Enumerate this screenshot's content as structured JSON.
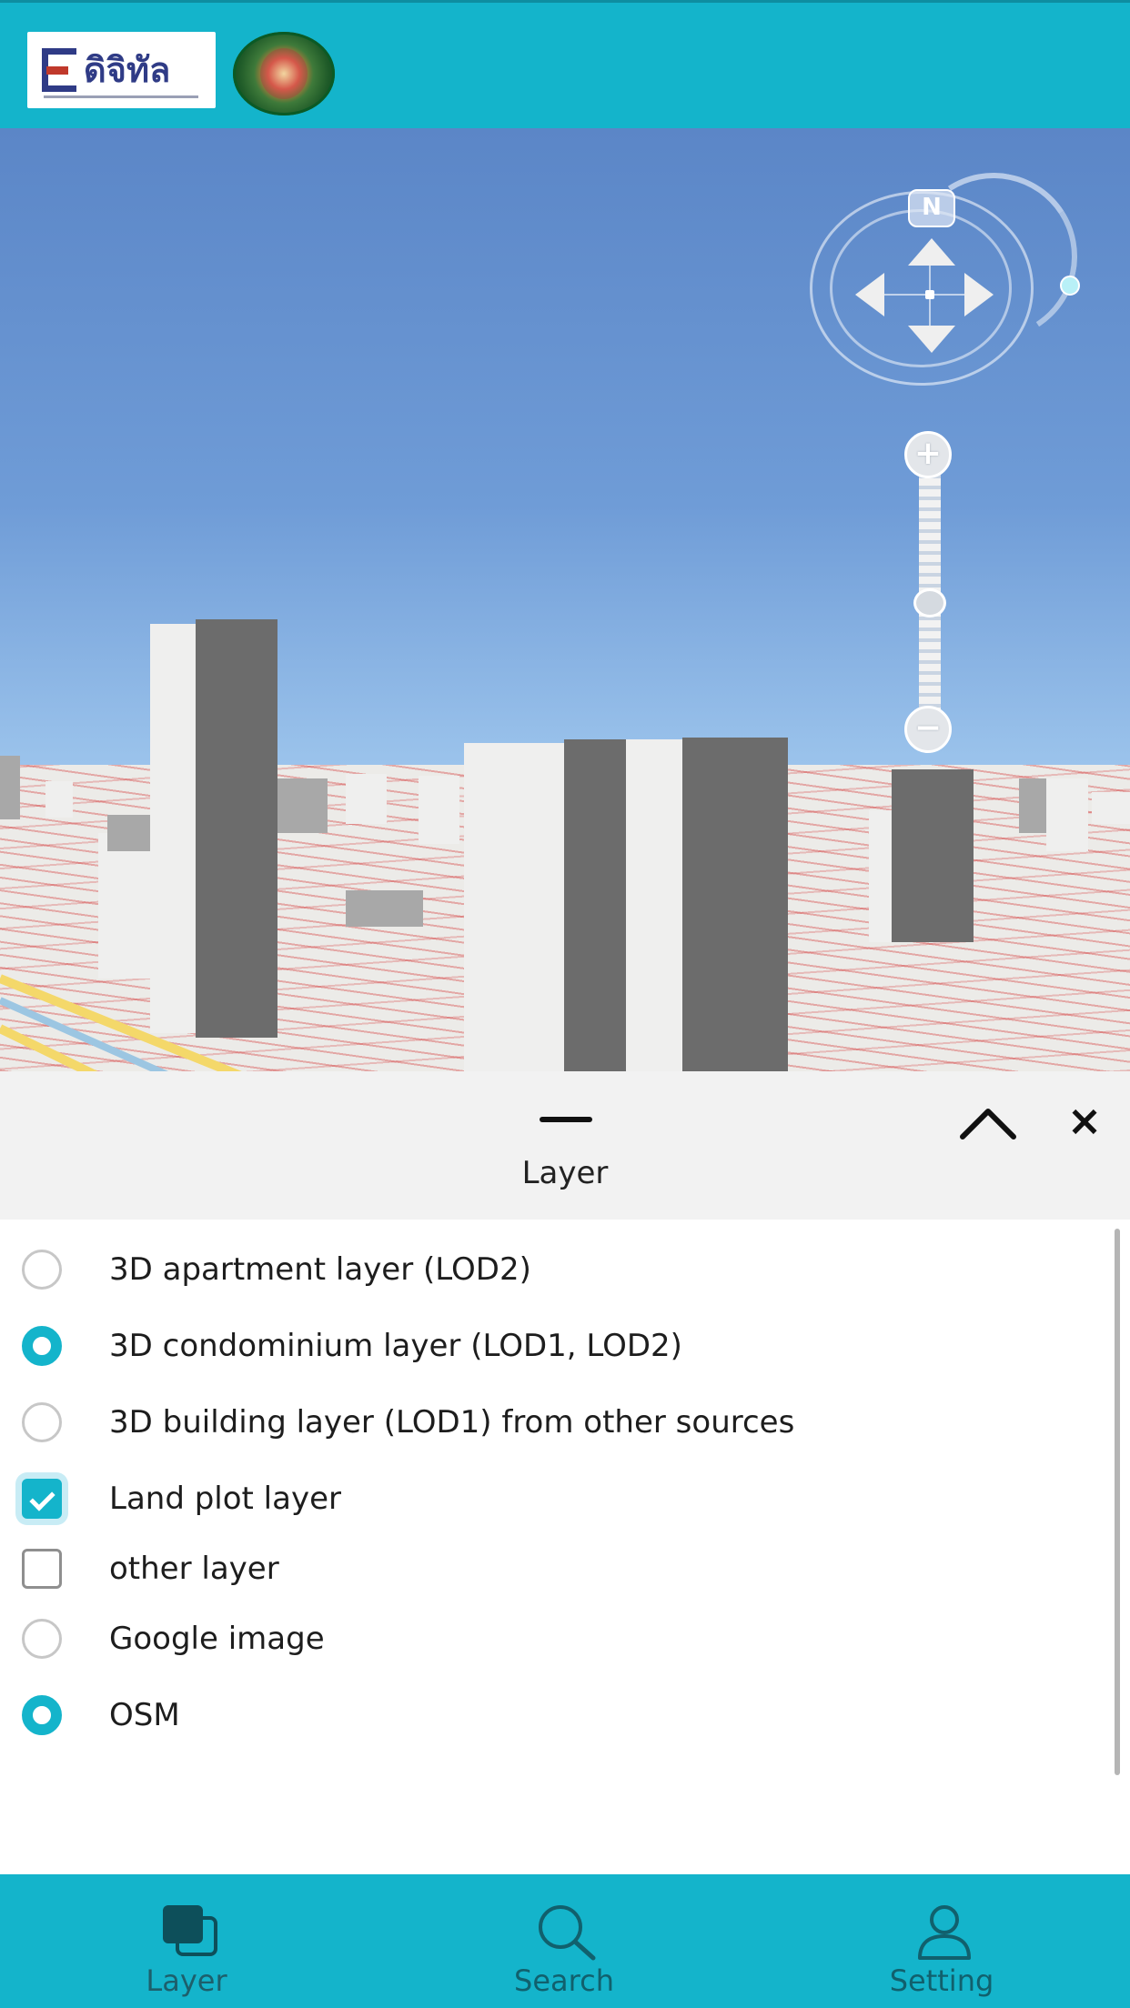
{
  "header": {
    "logo_text": "ดิจิทัล",
    "logo_icon": "edigital-logo",
    "seal_icon": "government-seal"
  },
  "map": {
    "compass": {
      "north_label": "N"
    },
    "zoom": {
      "in_label": "+",
      "out_label": "−"
    }
  },
  "panel": {
    "title": "Layer",
    "close_label": "×"
  },
  "layers": [
    {
      "label": "3D apartment layer (LOD2)",
      "type": "radio",
      "selected": false
    },
    {
      "label": "3D condominium layer (LOD1, LOD2)",
      "type": "radio",
      "selected": true
    },
    {
      "label": "3D building layer (LOD1) from other sources",
      "type": "radio",
      "selected": false
    },
    {
      "label": "Land plot layer",
      "type": "checkbox",
      "selected": true
    },
    {
      "label": "other layer",
      "type": "checkbox",
      "selected": false
    },
    {
      "label": "Google image",
      "type": "radio",
      "selected": false
    },
    {
      "label": "OSM",
      "type": "radio",
      "selected": true
    }
  ],
  "bottom_nav": {
    "items": [
      {
        "label": "Layer",
        "icon": "layers-icon",
        "active": true
      },
      {
        "label": "Search",
        "icon": "search-icon",
        "active": false
      },
      {
        "label": "Setting",
        "icon": "user-icon",
        "active": false
      }
    ]
  },
  "colors": {
    "accent": "#14b4cb",
    "panel_bg": "#f2f2f2"
  }
}
